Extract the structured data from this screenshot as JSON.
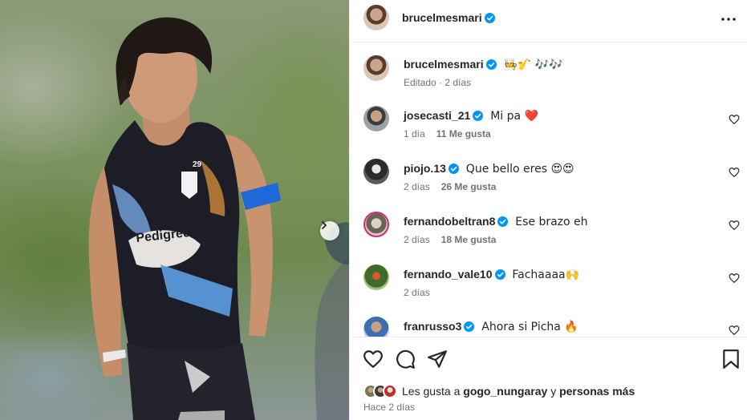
{
  "post": {
    "author": "brucelmesmari",
    "caption_emojis": "🧑‍🍳🎷 🎶🎶",
    "caption_meta": "Editado · 2 días"
  },
  "comments": [
    {
      "user": "josecasti_21",
      "text": "Mi pa ❤️",
      "time": "1 día",
      "likes": "11 Me gusta"
    },
    {
      "user": "piojo.13",
      "text": "Que bello eres 😍😍",
      "time": "2 días",
      "likes": "26 Me gusta"
    },
    {
      "user": "fernandobeltran8",
      "text": "Ese brazo eh",
      "time": "2 días",
      "likes": "18 Me gusta"
    },
    {
      "user": "fernando_vale10",
      "text": "Fachaaaa🙌",
      "time": "2 días",
      "likes": ""
    },
    {
      "user": "franrusso3",
      "text": "Ahora si Picha 🔥",
      "time": "",
      "likes": ""
    }
  ],
  "likes": {
    "prefix": "Les gusta a",
    "user": "gogo_nungaray",
    "middle": "y",
    "suffix": "personas más"
  },
  "posted_ago": "Hace 2 días",
  "photo": {
    "jersey_number": "29",
    "sponsor": "Pedigree"
  },
  "colors": {
    "verified": "#0095f6",
    "text": "#262626",
    "secondary": "#737373",
    "border": "#efefef",
    "heart_red": "#ff3040"
  },
  "icons": [
    "more-icon",
    "next-icon",
    "heart-icon",
    "comment-icon",
    "share-icon",
    "bookmark-icon",
    "verified-icon"
  ]
}
